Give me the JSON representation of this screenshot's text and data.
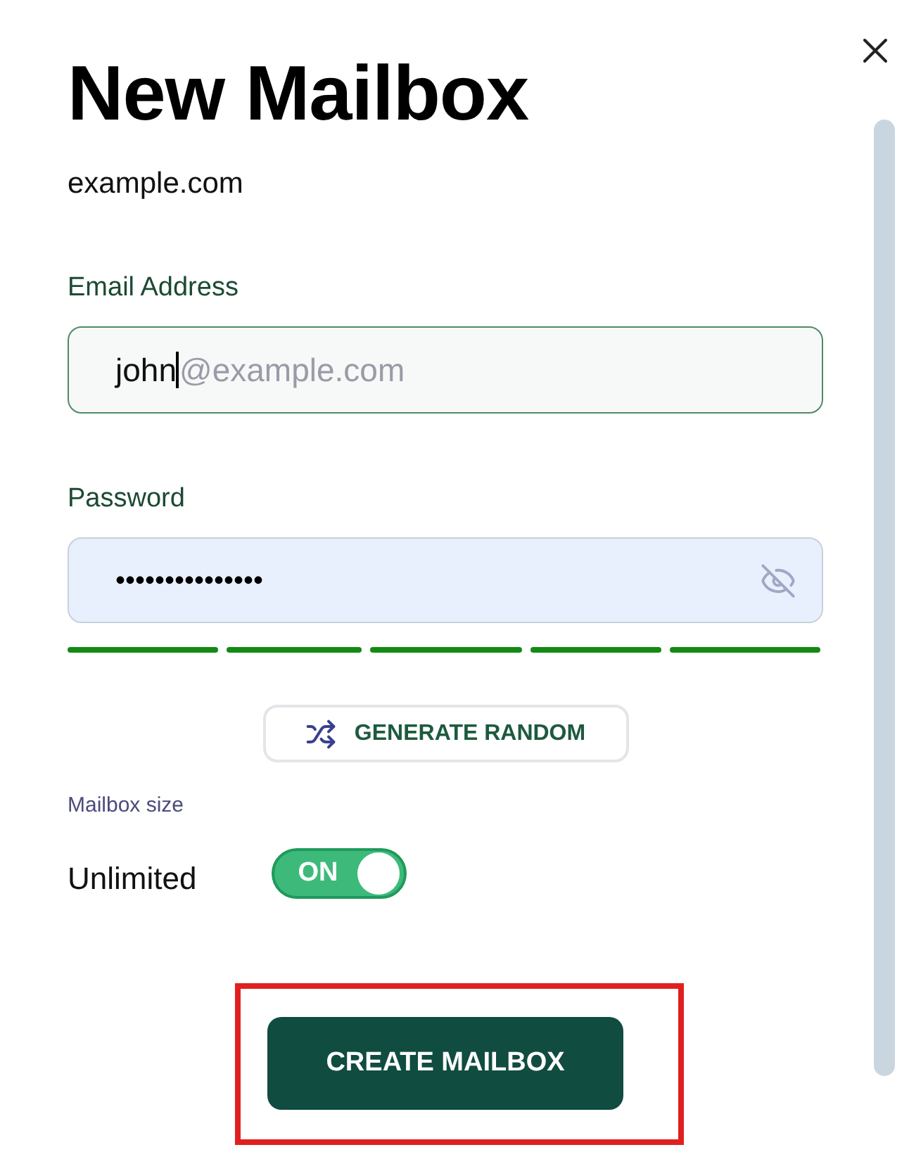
{
  "dialog": {
    "title": "New Mailbox",
    "subtitle": "example.com"
  },
  "email": {
    "label": "Email Address",
    "value": "john",
    "suffix": "@example.com",
    "focused": true
  },
  "password": {
    "label": "Password",
    "value": "•••••••••••••••",
    "autofilled": true
  },
  "strength_bars": [
    {
      "filled": true
    },
    {
      "filled": true
    },
    {
      "filled": true
    },
    {
      "filled": true
    },
    {
      "filled": true
    }
  ],
  "generate_button": {
    "label": "GENERATE RANDOM"
  },
  "mailbox_size": {
    "heading": "Mailbox size",
    "label": "Unlimited",
    "toggle": {
      "on": true,
      "text": "ON"
    }
  },
  "create_button": {
    "label": "CREATE MAILBOX",
    "highlighted": true
  }
}
